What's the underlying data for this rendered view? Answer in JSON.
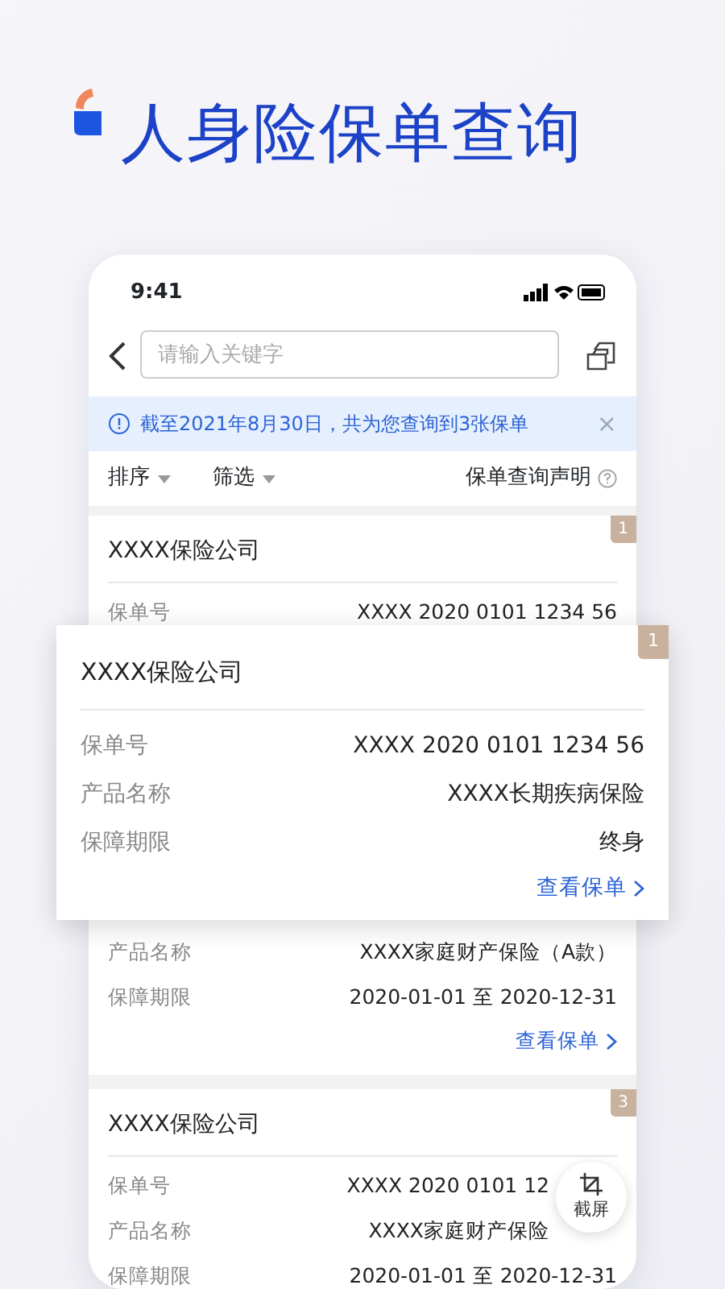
{
  "headline": "人身险保单查询",
  "status_bar": {
    "time": "9:41"
  },
  "search": {
    "placeholder": "请输入关键字"
  },
  "notice": {
    "text": "截至2021年8月30日，共为您查询到3张保单",
    "close": "×"
  },
  "toolbar": {
    "sort": "排序",
    "filter": "筛选",
    "statement": "保单查询声明"
  },
  "policies": [
    {
      "badge": "1",
      "company": "XXXX保险公司",
      "fields": [
        {
          "label": "保单号",
          "value": "XXXX 2020 0101 1234 56"
        }
      ]
    },
    {
      "fields": [
        {
          "label": "产品名称",
          "value": "XXXX家庭财产保险（A款）"
        },
        {
          "label": "保障期限",
          "value": "2020-01-01 至 2020-12-31"
        }
      ],
      "link": "查看保单"
    },
    {
      "badge": "3",
      "company": "XXXX保险公司",
      "fields": [
        {
          "label": "保单号",
          "value": "XXXX 2020 0101 12"
        },
        {
          "label": "产品名称",
          "value": "XXXX家庭财产保险"
        },
        {
          "label": "保障期限",
          "value": "2020-01-01 至 2020-12-31"
        }
      ]
    }
  ],
  "popup": {
    "badge": "1",
    "company": "XXXX保险公司",
    "fields": [
      {
        "label": "保单号",
        "value": "XXXX 2020 0101 1234 56"
      },
      {
        "label": "产品名称",
        "value": "XXXX长期疾病保险"
      },
      {
        "label": "保障期限",
        "value": "终身"
      }
    ],
    "link": "查看保单"
  },
  "fab": {
    "label": "截屏"
  }
}
